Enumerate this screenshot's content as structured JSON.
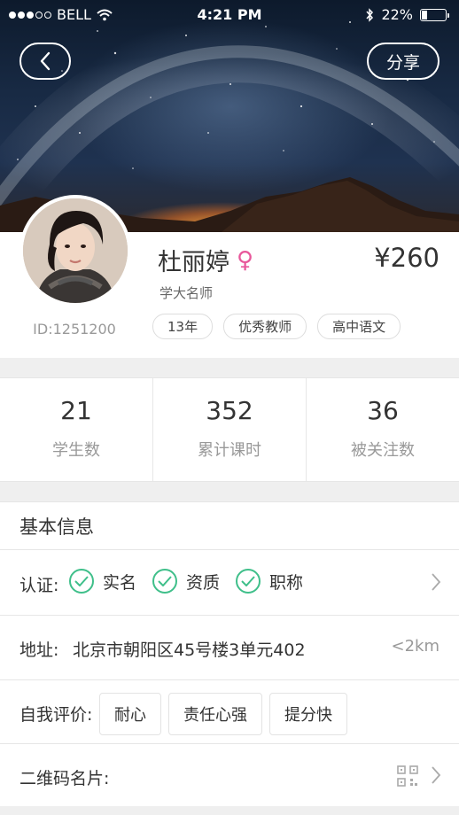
{
  "status_bar": {
    "carrier": "BELL",
    "time": "4:21 PM",
    "battery": "22%",
    "battery_level": 0.22
  },
  "header": {
    "share_label": "分享"
  },
  "profile": {
    "name": "杜丽婷",
    "gender_symbol": "♀",
    "price": "¥260",
    "title": "学大名师",
    "id": "ID:1251200",
    "tags": [
      "13年",
      "优秀教师",
      "高中语文"
    ]
  },
  "stats": [
    {
      "value": "21",
      "label": "学生数"
    },
    {
      "value": "352",
      "label": "累计课时"
    },
    {
      "value": "36",
      "label": "被关注数"
    }
  ],
  "info": {
    "heading": "基本信息",
    "cert_label": "认证:",
    "certs": [
      "实名",
      "资质",
      "职称"
    ],
    "addr_label": "地址:",
    "address": "北京市朝阳区45号楼3单元402",
    "distance": "<2km",
    "eval_label": "自我评价:",
    "eval_tags": [
      "耐心",
      "责任心强",
      "提分快"
    ],
    "qr_label": "二维码名片:"
  },
  "colors": {
    "check_green": "#3fbf8a",
    "female_pink": "#e8589b"
  }
}
